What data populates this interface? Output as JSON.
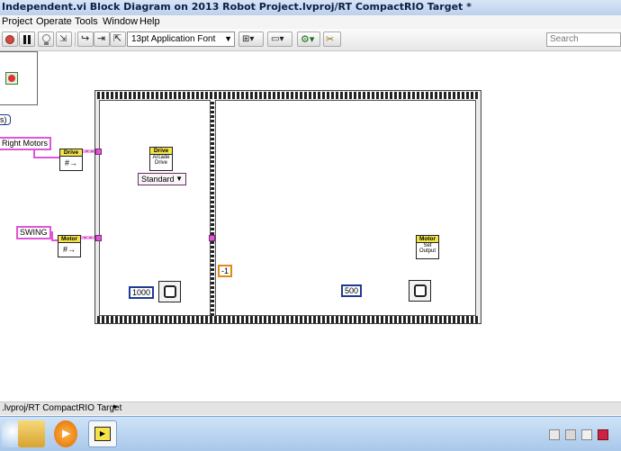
{
  "window": {
    "title": "Independent.vi Block Diagram on 2013 Robot Project.lvproj/RT CompactRIO Target *"
  },
  "menu": {
    "items": [
      "Project",
      "Operate",
      "Tools",
      "Window",
      "Help"
    ]
  },
  "toolbar": {
    "font_label": "13pt Application Font",
    "search_placeholder": "Search"
  },
  "diagram": {
    "right_motors_label": "Right Motors",
    "partial_label_left": "s)",
    "swing_label": "SWING",
    "drive_node": {
      "title": "Drive"
    },
    "motor_node": {
      "title": "Motor"
    },
    "arcade_drive": {
      "title": "Drive",
      "line1": "Arcade",
      "line2": "Drive"
    },
    "standard_label": "Standard",
    "wait_const_1": "1000",
    "neg_one_const": "-1",
    "motor_set_output": {
      "title": "Motor",
      "line1": "Set",
      "line2": "Output"
    },
    "wait_const_2": "500"
  },
  "status": {
    "text": ".lvproj/RT CompactRIO Target"
  },
  "colors": {
    "wire_pink": "#e055d5",
    "wire_blue": "#1f3a93",
    "wire_orange": "#e08a1a",
    "node_header": "#f4e44c"
  }
}
